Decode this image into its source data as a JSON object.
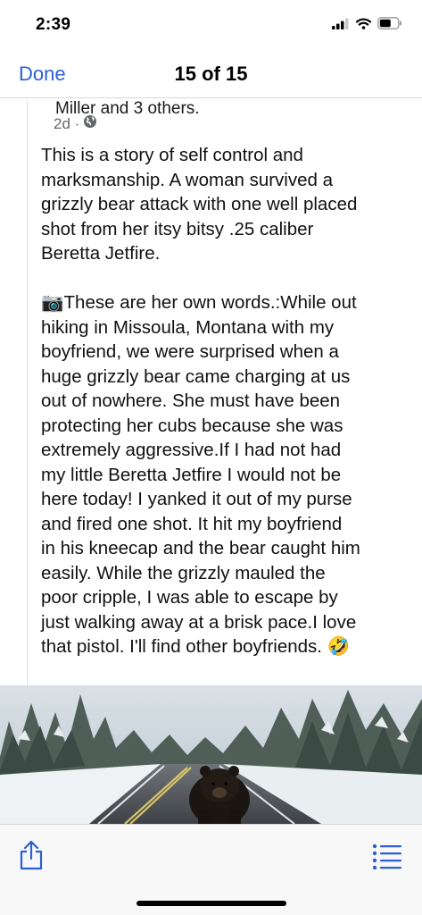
{
  "status_bar": {
    "time": "2:39"
  },
  "nav": {
    "done_label": "Done",
    "title": "15 of 15"
  },
  "post": {
    "author_line": "Miller and 3 others.",
    "time_ago": "2d ·",
    "paragraph1_lines": [
      "This is a story of self control and",
      "marksmanship.  A woman survived a",
      "grizzly bear attack with one well placed",
      "shot from her itsy bitsy .25 caliber",
      "Beretta Jetfire."
    ],
    "paragraph2_lines": [
      "📷These are her own words.:While out",
      "hiking in Missoula, Montana with my",
      "boyfriend, we were surprised when a",
      "huge grizzly bear came charging at us",
      "out of nowhere.  She must have been",
      "protecting her cubs because she was",
      "extremely aggressive.If I had not had",
      "my little Beretta Jetfire I would not be",
      "here today!  I yanked it out of my purse",
      "and fired one shot.  It hit my boyfriend",
      "in his kneecap and the bear caught him",
      "easily. While the grizzly mauled the",
      "poor cripple, I was able to escape by",
      "just walking away at a brisk pace.I love",
      "that pistol.  I'll find other boyfriends. 🤣"
    ]
  },
  "icons": {
    "privacy": "globe-icon",
    "share": "share-icon",
    "list": "list-icon"
  },
  "colors": {
    "accent": "#2b5fd3"
  }
}
